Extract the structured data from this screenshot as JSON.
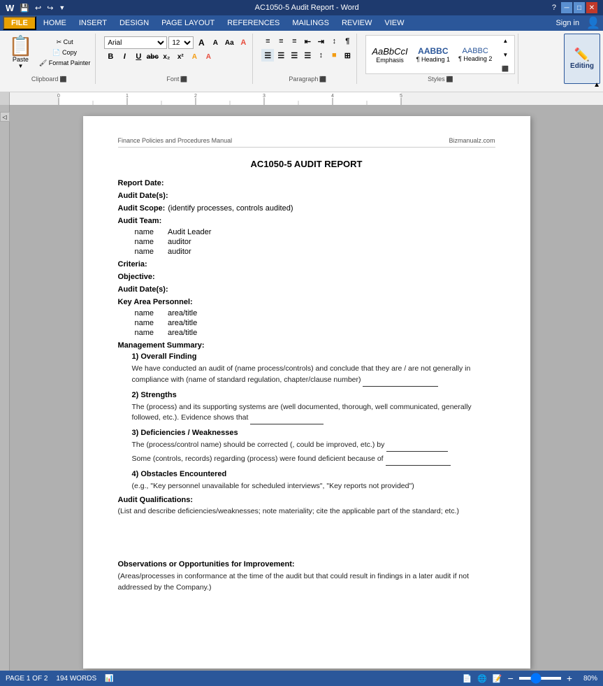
{
  "window": {
    "title": "AC1050-5 Audit Report - Word",
    "controls": [
      "minimize",
      "restore",
      "close"
    ]
  },
  "menu_bar": {
    "file_label": "FILE",
    "tabs": [
      "HOME",
      "INSERT",
      "DESIGN",
      "PAGE LAYOUT",
      "REFERENCES",
      "MAILINGS",
      "REVIEW",
      "VIEW"
    ],
    "sign_in": "Sign in"
  },
  "ribbon": {
    "clipboard_label": "Clipboard",
    "font_label": "Font",
    "paragraph_label": "Paragraph",
    "styles_label": "Styles",
    "paste_label": "Paste",
    "font_name": "Arial",
    "font_size": "12",
    "bold": "B",
    "italic": "I",
    "underline": "U",
    "strikethrough": "abc",
    "subscript": "x₂",
    "superscript": "x²",
    "styles": [
      {
        "name": "AaBbCcI",
        "label": "Emphasis"
      },
      {
        "name": "AABBC",
        "label": "¶ Heading 1"
      },
      {
        "name": "AABBC",
        "label": "¶ Heading 2"
      }
    ],
    "editing_label": "Editing"
  },
  "document": {
    "header_left": "Finance Policies and Procedures Manual",
    "header_right": "Bizmanualz.com",
    "title": "AC1050-5 AUDIT REPORT",
    "fields": [
      {
        "label": "Report Date:",
        "value": ""
      },
      {
        "label": "Audit Date(s):",
        "value": ""
      },
      {
        "label": "Audit Scope:",
        "value": "(identify processes, controls audited)"
      }
    ],
    "audit_team_label": "Audit Team:",
    "audit_team_members": [
      {
        "name": "name",
        "role": "Audit Leader"
      },
      {
        "name": "name",
        "role": "auditor"
      },
      {
        "name": "name",
        "role": "auditor"
      }
    ],
    "criteria_label": "Criteria:",
    "objective_label": "Objective:",
    "audit_dates_label": "Audit Date(s):",
    "key_personnel_label": "Key Area Personnel:",
    "key_personnel": [
      {
        "name": "name",
        "role": "area/title"
      },
      {
        "name": "name",
        "role": "area/title"
      },
      {
        "name": "name",
        "role": "area/title"
      }
    ],
    "management_summary_label": "Management Summary:",
    "sections": [
      {
        "number": "1)",
        "title": "Overall Finding",
        "text": "We have conducted an audit of (name process/controls) and conclude that they are / are not generally in compliance with (name of standard regulation, chapter/clause number)"
      },
      {
        "number": "2)",
        "title": "Strengths",
        "text": "The (process) and its supporting systems are (well documented, thorough, well communicated, generally followed, etc.).  Evidence shows that"
      },
      {
        "number": "3)",
        "title": "Deficiencies / Weaknesses",
        "text1": "The (process/control name) should be corrected (, could be improved, etc.) by",
        "text2": "Some (controls, records) regarding (process) were found deficient because of"
      },
      {
        "number": "4)",
        "title": "Obstacles Encountered",
        "text": "(e.g., \"Key personnel unavailable for scheduled interviews\", \"Key reports not provided\")"
      }
    ],
    "audit_qualifications_label": "Audit Qualifications:",
    "audit_qualifications_text": "(List and describe deficiencies/weaknesses; note materiality; cite the applicable part of the standard; etc.)",
    "observations_label": "Observations or Opportunities for Improvement:",
    "observations_text": "(Areas/processes in conformance at the time of the audit but that could result in findings in a later audit if not addressed by the Company.)"
  },
  "status_bar": {
    "page_info": "PAGE 1 OF 2",
    "word_count": "194 WORDS",
    "zoom_level": "80%",
    "zoom_value": 80
  }
}
